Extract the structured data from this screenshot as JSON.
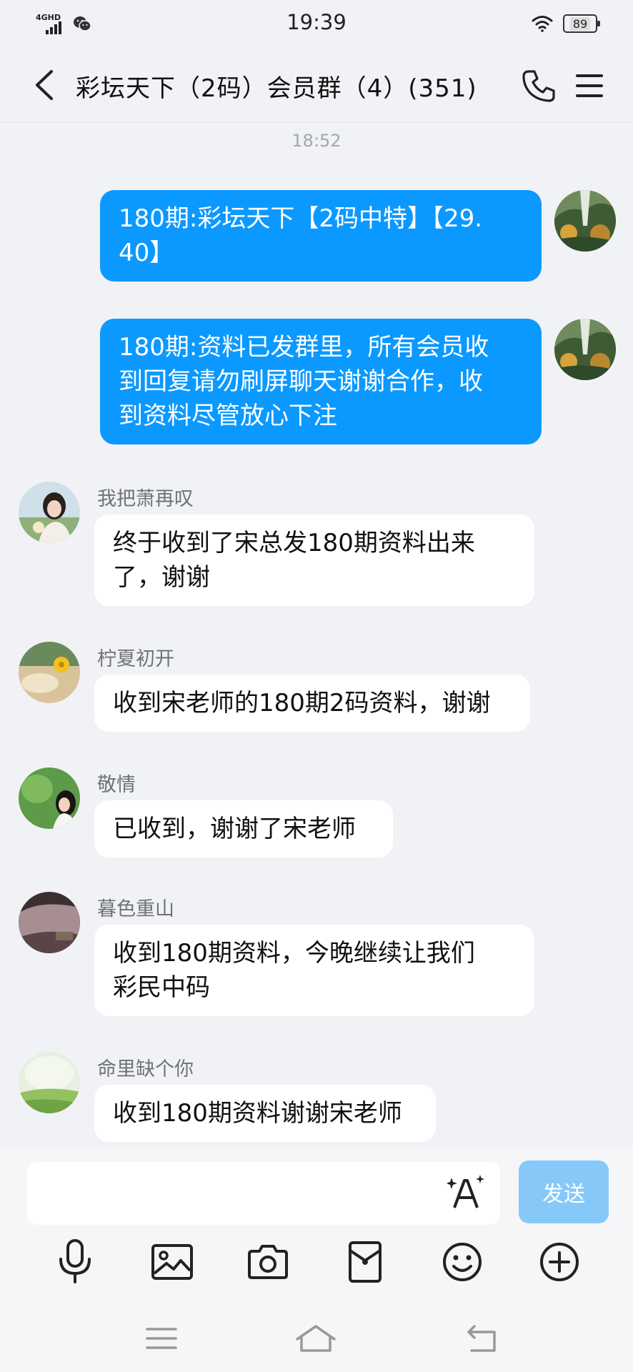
{
  "status_bar": {
    "network": "4GHD",
    "time": "19:39",
    "battery": "89"
  },
  "header": {
    "title": "彩坛天下（2码）会员群（4）(351)"
  },
  "chat": {
    "time_label": "18:52",
    "sent": [
      {
        "text": "180期:彩坛天下【2码中特】【29.\n40】"
      },
      {
        "text": "180期:资料已发群里，所有会员收\n到回复请勿刷屏聊天谢谢合作，收\n到资料尽管放心下注"
      }
    ],
    "received": [
      {
        "nickname": "我把萧再叹",
        "text": "终于收到了宋总发180期资料出来\n了，谢谢"
      },
      {
        "nickname": "柠夏初开",
        "text": "收到宋老师的180期2码资料，谢谢"
      },
      {
        "nickname": "敬情",
        "text": "已收到，谢谢了宋老师"
      },
      {
        "nickname": "暮色重山",
        "text": "收到180期资料，今晚继续让我们\n彩民中码"
      },
      {
        "nickname": "命里缺个你",
        "text": "收到180期资料谢谢宋老师"
      }
    ]
  },
  "input": {
    "placeholder": "",
    "send_label": "发送"
  },
  "colors": {
    "sent_bubble": "#0b99ff",
    "send_button_disabled": "#86c9f9",
    "background": "#f1f2f6"
  }
}
